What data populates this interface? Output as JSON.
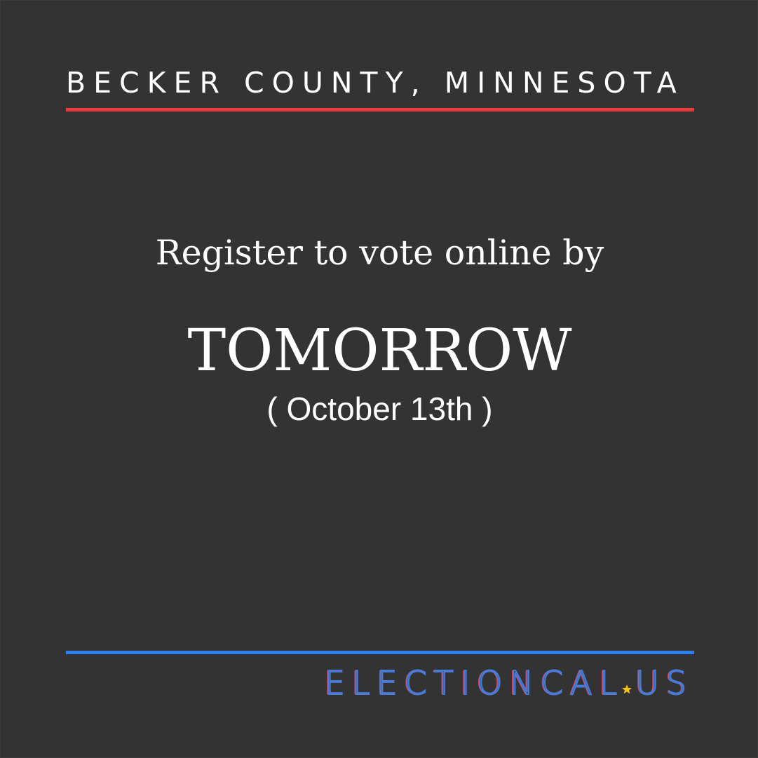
{
  "header": {
    "region": "BECKER COUNTY, MINNESOTA"
  },
  "message": {
    "lead": "Register to vote online by",
    "deadline": "TOMORROW",
    "date": "( October 13th )"
  },
  "brand": {
    "name_part1": "ELECTIONCAL",
    "name_part2": "US",
    "separator_icon": "star-icon"
  },
  "colors": {
    "background": "#333333",
    "top_rule": "#ee3a3a",
    "bottom_rule": "#2f7ff0",
    "text": "#ffffff",
    "brand_blue": "#4a7bd8",
    "brand_red": "#e8404a",
    "star": "#f3c21a"
  }
}
